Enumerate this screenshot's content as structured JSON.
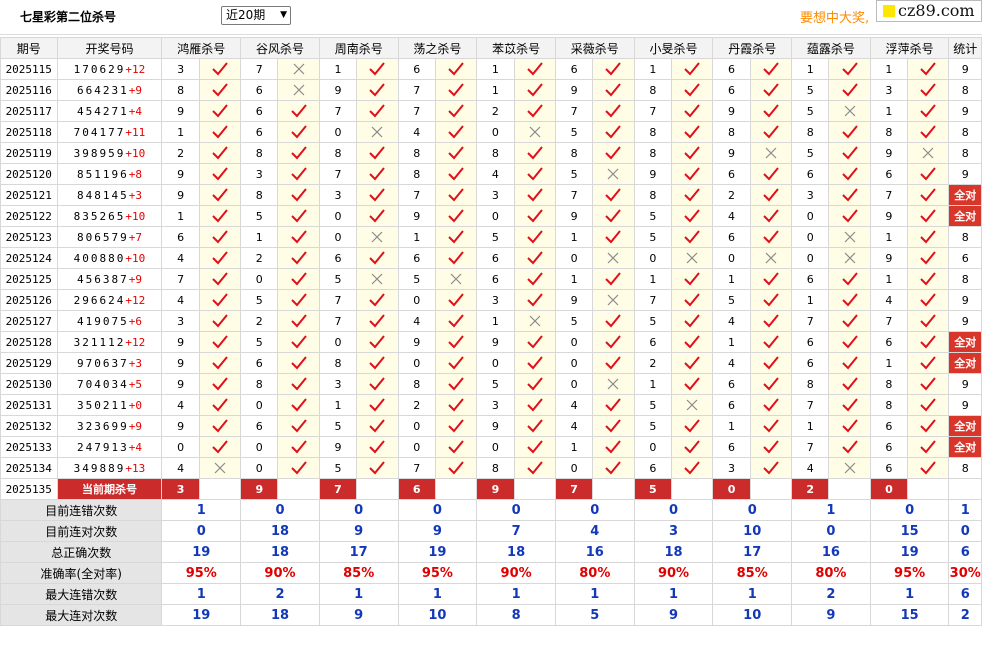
{
  "header": {
    "title": "七星彩第二位杀号",
    "period_select": "近20期",
    "promo": "要想中大奖,",
    "brand": "cz89.com"
  },
  "columns": {
    "period": "期号",
    "numbers": "开奖号码",
    "experts": [
      "鸿雁杀号",
      "谷风杀号",
      "周南杀号",
      "荡之杀号",
      "苯苡杀号",
      "采薇杀号",
      "小旻杀号",
      "丹霞杀号",
      "蕴露杀号",
      "浮萍杀号"
    ],
    "stats": "统计"
  },
  "rows": [
    {
      "period": "2025115",
      "nums": "170629",
      "plus": "+12",
      "kills": [
        3,
        7,
        1,
        6,
        1,
        6,
        1,
        6,
        1,
        1
      ],
      "ok": [
        1,
        0,
        1,
        1,
        1,
        1,
        1,
        1,
        1,
        1
      ],
      "stat": "9"
    },
    {
      "period": "2025116",
      "nums": "664231",
      "plus": "+9",
      "kills": [
        8,
        6,
        9,
        7,
        1,
        9,
        8,
        6,
        5,
        3
      ],
      "ok": [
        1,
        0,
        1,
        1,
        1,
        1,
        1,
        1,
        1,
        1
      ],
      "stat": "8"
    },
    {
      "period": "2025117",
      "nums": "454271",
      "plus": "+4",
      "kills": [
        9,
        6,
        7,
        7,
        2,
        7,
        7,
        9,
        5,
        1
      ],
      "ok": [
        1,
        1,
        1,
        1,
        1,
        1,
        1,
        1,
        0,
        1
      ],
      "stat": "9"
    },
    {
      "period": "2025118",
      "nums": "704177",
      "plus": "+11",
      "kills": [
        1,
        6,
        0,
        4,
        0,
        5,
        8,
        8,
        8,
        8
      ],
      "ok": [
        1,
        1,
        0,
        1,
        0,
        1,
        1,
        1,
        1,
        1
      ],
      "stat": "8"
    },
    {
      "period": "2025119",
      "nums": "398959",
      "plus": "+10",
      "kills": [
        2,
        8,
        8,
        8,
        8,
        8,
        8,
        9,
        5,
        9
      ],
      "ok": [
        1,
        1,
        1,
        1,
        1,
        1,
        1,
        0,
        1,
        0
      ],
      "stat": "8"
    },
    {
      "period": "2025120",
      "nums": "851196",
      "plus": "+8",
      "kills": [
        9,
        3,
        7,
        8,
        4,
        5,
        9,
        6,
        6,
        6
      ],
      "ok": [
        1,
        1,
        1,
        1,
        1,
        0,
        1,
        1,
        1,
        1
      ],
      "stat": "9"
    },
    {
      "period": "2025121",
      "nums": "848145",
      "plus": "+3",
      "kills": [
        9,
        8,
        3,
        7,
        3,
        7,
        8,
        2,
        3,
        7
      ],
      "ok": [
        1,
        1,
        1,
        1,
        1,
        1,
        1,
        1,
        1,
        1
      ],
      "stat": "全对"
    },
    {
      "period": "2025122",
      "nums": "835265",
      "plus": "+10",
      "kills": [
        1,
        5,
        0,
        9,
        0,
        9,
        5,
        4,
        0,
        9
      ],
      "ok": [
        1,
        1,
        1,
        1,
        1,
        1,
        1,
        1,
        1,
        1
      ],
      "stat": "全对"
    },
    {
      "period": "2025123",
      "nums": "806579",
      "plus": "+7",
      "kills": [
        6,
        1,
        0,
        1,
        5,
        1,
        5,
        6,
        0,
        1
      ],
      "ok": [
        1,
        1,
        0,
        1,
        1,
        1,
        1,
        1,
        0,
        1
      ],
      "stat": "8"
    },
    {
      "period": "2025124",
      "nums": "400880",
      "plus": "+10",
      "kills": [
        4,
        2,
        6,
        6,
        6,
        0,
        0,
        0,
        0,
        9
      ],
      "ok": [
        1,
        1,
        1,
        1,
        1,
        0,
        0,
        0,
        0,
        1
      ],
      "stat": "6"
    },
    {
      "period": "2025125",
      "nums": "456387",
      "plus": "+9",
      "kills": [
        7,
        0,
        5,
        5,
        6,
        1,
        1,
        1,
        6,
        1
      ],
      "ok": [
        1,
        1,
        0,
        0,
        1,
        1,
        1,
        1,
        1,
        1
      ],
      "stat": "8"
    },
    {
      "period": "2025126",
      "nums": "296624",
      "plus": "+12",
      "kills": [
        4,
        5,
        7,
        0,
        3,
        9,
        7,
        5,
        1,
        4
      ],
      "ok": [
        1,
        1,
        1,
        1,
        1,
        0,
        1,
        1,
        1,
        1
      ],
      "stat": "9"
    },
    {
      "period": "2025127",
      "nums": "419075",
      "plus": "+6",
      "kills": [
        3,
        2,
        7,
        4,
        1,
        5,
        5,
        4,
        7,
        7
      ],
      "ok": [
        1,
        1,
        1,
        1,
        0,
        1,
        1,
        1,
        1,
        1
      ],
      "stat": "9"
    },
    {
      "period": "2025128",
      "nums": "321112",
      "plus": "+12",
      "kills": [
        9,
        5,
        0,
        9,
        9,
        0,
        6,
        1,
        6,
        6
      ],
      "ok": [
        1,
        1,
        1,
        1,
        1,
        1,
        1,
        1,
        1,
        1
      ],
      "stat": "全对"
    },
    {
      "period": "2025129",
      "nums": "970637",
      "plus": "+3",
      "kills": [
        9,
        6,
        8,
        0,
        0,
        0,
        2,
        4,
        6,
        1
      ],
      "ok": [
        1,
        1,
        1,
        1,
        1,
        1,
        1,
        1,
        1,
        1
      ],
      "stat": "全对"
    },
    {
      "period": "2025130",
      "nums": "704034",
      "plus": "+5",
      "kills": [
        9,
        8,
        3,
        8,
        5,
        0,
        1,
        6,
        8,
        8
      ],
      "ok": [
        1,
        1,
        1,
        1,
        1,
        0,
        1,
        1,
        1,
        1
      ],
      "stat": "9"
    },
    {
      "period": "2025131",
      "nums": "350211",
      "plus": "+0",
      "kills": [
        4,
        0,
        1,
        2,
        3,
        4,
        5,
        6,
        7,
        8
      ],
      "ok": [
        1,
        1,
        1,
        1,
        1,
        1,
        0,
        1,
        1,
        1
      ],
      "stat": "9"
    },
    {
      "period": "2025132",
      "nums": "323699",
      "plus": "+9",
      "kills": [
        9,
        6,
        5,
        0,
        9,
        4,
        5,
        1,
        1,
        6
      ],
      "ok": [
        1,
        1,
        1,
        1,
        1,
        1,
        1,
        1,
        1,
        1
      ],
      "stat": "全对"
    },
    {
      "period": "2025133",
      "nums": "247913",
      "plus": "+4",
      "kills": [
        0,
        0,
        9,
        0,
        0,
        1,
        0,
        6,
        7,
        6
      ],
      "ok": [
        1,
        1,
        1,
        1,
        1,
        1,
        1,
        1,
        1,
        1
      ],
      "stat": "全对"
    },
    {
      "period": "2025134",
      "nums": "349889",
      "plus": "+13",
      "kills": [
        4,
        0,
        5,
        7,
        8,
        0,
        6,
        3,
        4,
        6
      ],
      "ok": [
        0,
        1,
        1,
        1,
        1,
        1,
        1,
        1,
        0,
        1
      ],
      "stat": "8"
    }
  ],
  "current": {
    "period": "2025135",
    "label": "当前期杀号",
    "kills": [
      3,
      9,
      7,
      6,
      9,
      7,
      5,
      0,
      2,
      0
    ]
  },
  "stats": [
    {
      "label": "目前连错次数",
      "values": [
        "1",
        "0",
        "0",
        "0",
        "0",
        "0",
        "0",
        "0",
        "1",
        "0"
      ],
      "total": "1"
    },
    {
      "label": "目前连对次数",
      "values": [
        "0",
        "18",
        "9",
        "9",
        "7",
        "4",
        "3",
        "10",
        "0",
        "15"
      ],
      "total": "0"
    },
    {
      "label": "总正确次数",
      "values": [
        "19",
        "18",
        "17",
        "19",
        "18",
        "16",
        "18",
        "17",
        "16",
        "19"
      ],
      "total": "6"
    },
    {
      "label": "准确率(全对率)",
      "values": [
        "95%",
        "90%",
        "85%",
        "95%",
        "90%",
        "80%",
        "90%",
        "85%",
        "80%",
        "95%"
      ],
      "total": "30%",
      "red": true
    },
    {
      "label": "最大连错次数",
      "values": [
        "1",
        "2",
        "1",
        "1",
        "1",
        "1",
        "1",
        "1",
        "2",
        "1"
      ],
      "total": "6"
    },
    {
      "label": "最大连对次数",
      "values": [
        "19",
        "18",
        "9",
        "10",
        "8",
        "5",
        "9",
        "10",
        "9",
        "15"
      ],
      "total": "2"
    }
  ],
  "colors": {
    "check": "#e0101a",
    "cross": "#8a8a8a",
    "accent": "#d9362b",
    "statblue": "#1338b8"
  }
}
